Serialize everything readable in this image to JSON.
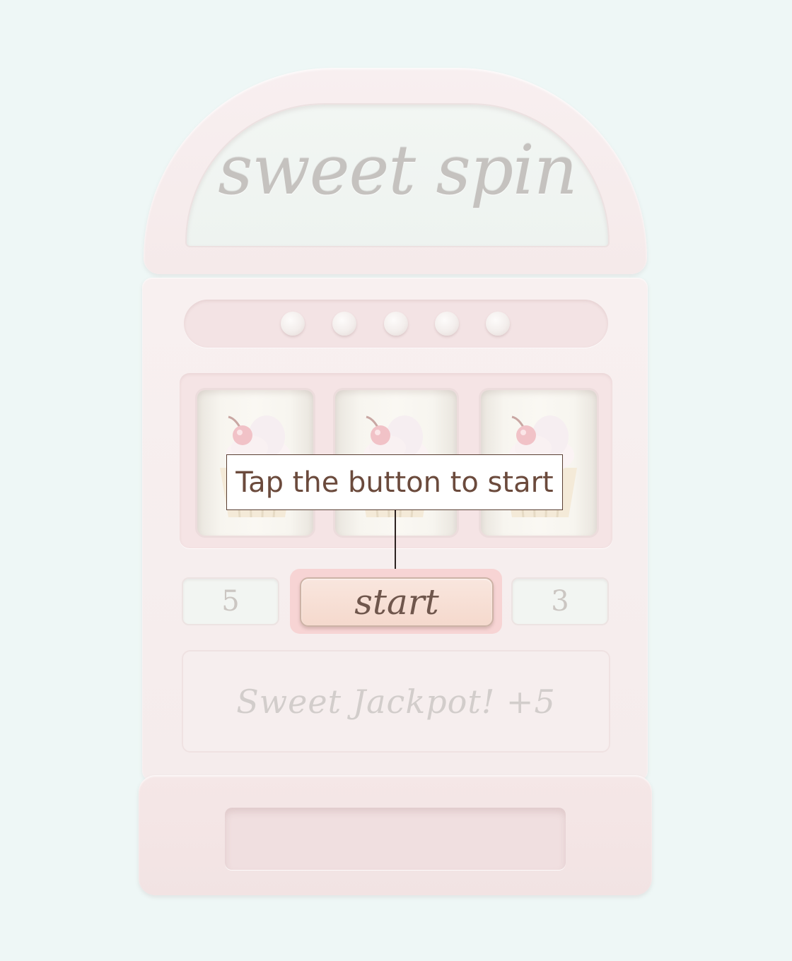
{
  "title": "sweet spin",
  "lights": [
    "light-1",
    "light-2",
    "light-3",
    "light-4",
    "light-5"
  ],
  "reels": [
    {
      "symbol": "cupcake-icon"
    },
    {
      "symbol": "cupcake-icon"
    },
    {
      "symbol": "cupcake-icon"
    }
  ],
  "tooltip": "Tap the button to start",
  "left_count": "5",
  "start_label": "start",
  "right_count": "3",
  "message": "Sweet Jackpot! +5",
  "colors": {
    "background": "#eef7f6",
    "machine": "#f7eeee",
    "start_button": "#f5d9cd",
    "start_surround": "#f7d4d4",
    "tooltip_text": "#6b4a3c"
  }
}
